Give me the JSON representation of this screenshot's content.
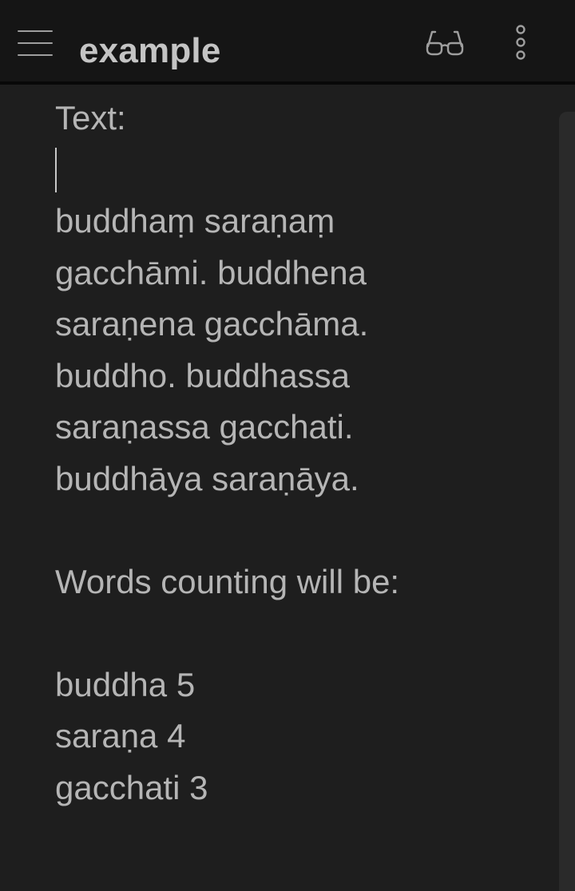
{
  "header": {
    "title": "example",
    "menu_icon": "hamburger-menu-icon",
    "reader_icon": "glasses-icon",
    "more_icon": "vertical-ellipsis-icon"
  },
  "editor": {
    "lines": [
      "Text:",
      "",
      "buddhaṃ saraṇaṃ",
      "gacchāmi. buddhena",
      "saraṇena gacchāma.",
      "buddho. buddhassa",
      "saraṇassa gacchati.",
      "buddhāya saraṇāya.",
      "",
      "Words counting will be:",
      "",
      "buddha 5",
      "saraṇa 4",
      "gacchati 3"
    ]
  },
  "colors": {
    "background": "#1e1e1e",
    "header_background": "#151515",
    "text": "#b5b5b5"
  }
}
